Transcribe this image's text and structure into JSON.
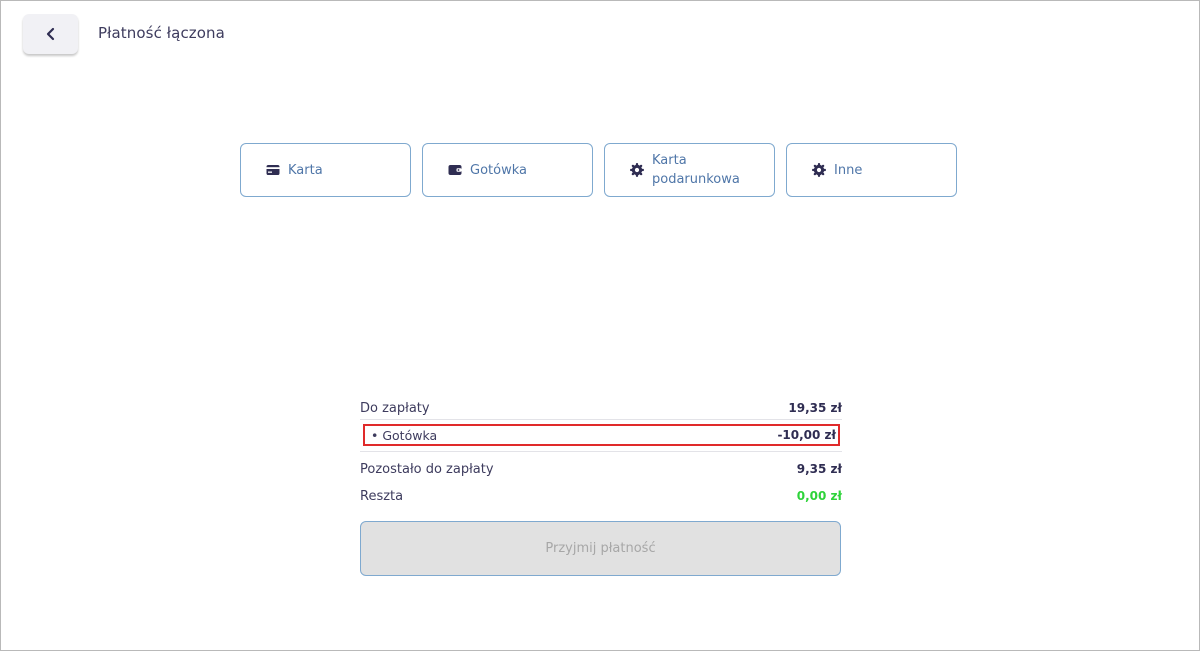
{
  "header": {
    "back_icon": "chevron-left-icon",
    "title": "Płatność łączona"
  },
  "methods": [
    {
      "label": "Karta",
      "icon": "credit-card-icon"
    },
    {
      "label": "Gotówka",
      "icon": "wallet-icon"
    },
    {
      "label": "Karta podarunkowa",
      "icon": "gift-card-icon"
    },
    {
      "label": "Inne",
      "icon": "other-payment-icon"
    }
  ],
  "summary": {
    "due_label": "Do zapłaty",
    "due_value": "19,35 zł",
    "item_label": "• Gotówka",
    "item_value": "-10,00 zł",
    "remaining_label": "Pozostało do zapłaty",
    "remaining_value": "9,35 zł",
    "change_label": "Reszta",
    "change_value": "0,00 zł"
  },
  "accept_button": {
    "label": "Przyjmij płatność",
    "disabled": true
  },
  "colors": {
    "accent": "#2f2d52",
    "border": "#7fa9cf",
    "method_text": "#4f76a8",
    "highlight_border": "#e02a2a",
    "change_positive": "#2ed33a",
    "disabled_bg": "#e1e1e1"
  }
}
